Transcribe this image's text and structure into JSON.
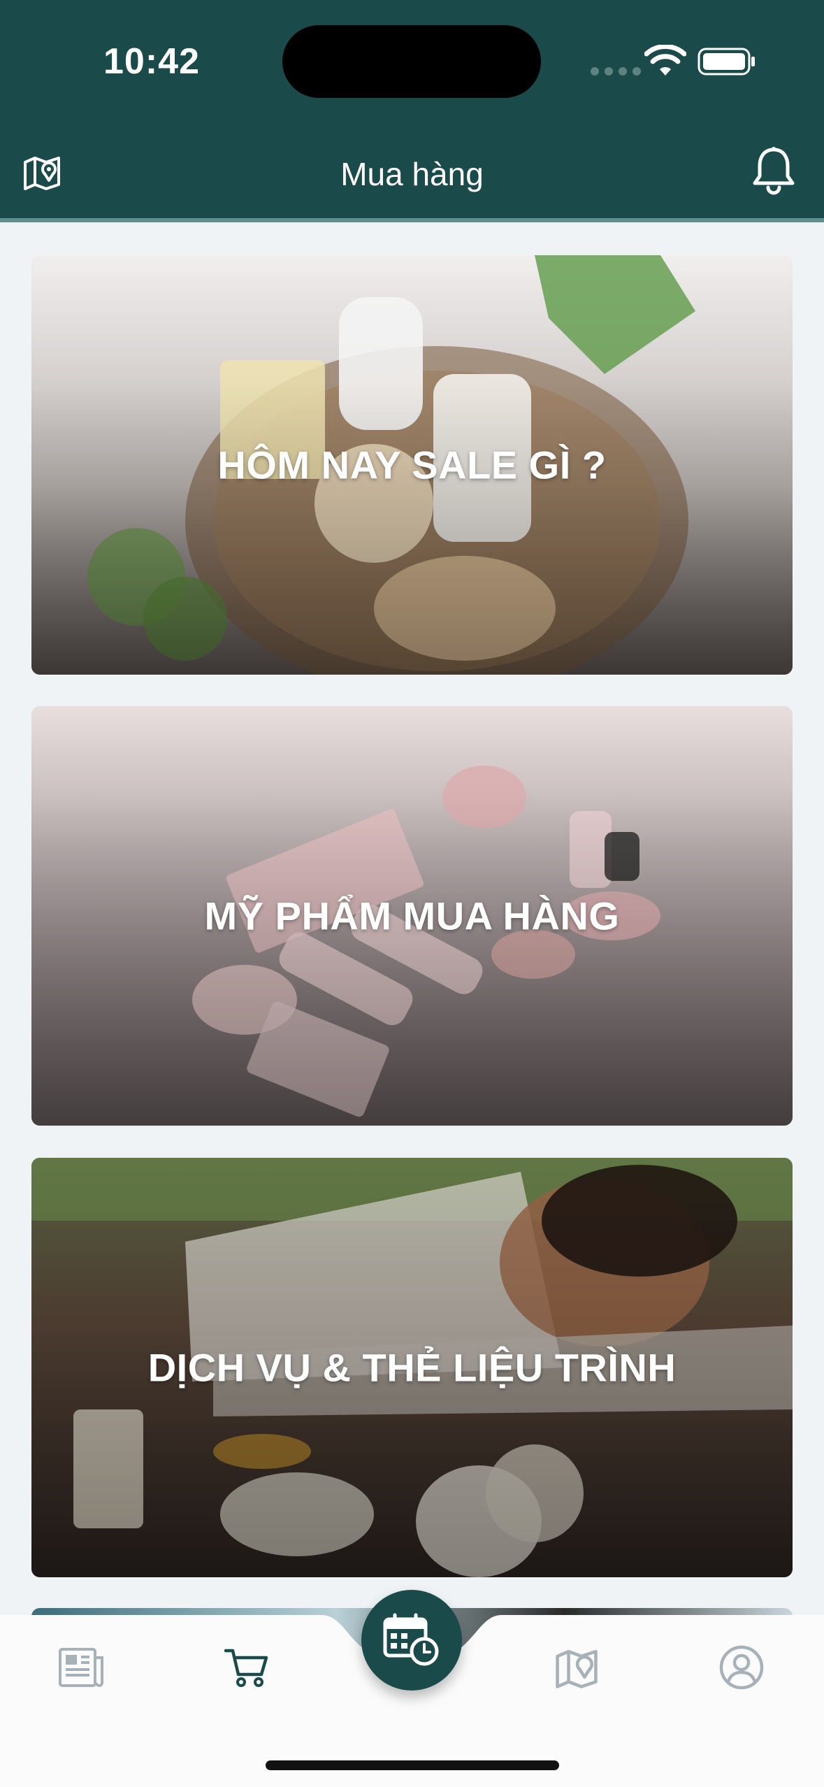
{
  "status_bar": {
    "time": "10:42"
  },
  "header": {
    "title": "Mua hàng"
  },
  "cards": [
    {
      "label": "HÔM NAY SALE GÌ ?"
    },
    {
      "label": "MỸ PHẨM MUA HÀNG"
    },
    {
      "label": "DỊCH VỤ & THẺ LIỆU TRÌNH"
    }
  ],
  "bottom_nav": {
    "items": [
      "newspaper-icon",
      "cart-icon",
      "calendar-clock-icon",
      "map-pin-icon",
      "user-circle-icon"
    ],
    "active": "cart-icon"
  },
  "colors": {
    "brand": "#1a4a4a",
    "background": "#eff3f6",
    "nav_inactive": "#a7b2b8"
  }
}
